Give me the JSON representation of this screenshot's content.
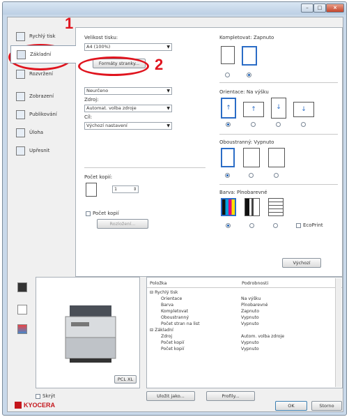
{
  "window": {
    "min_label": "–",
    "max_label": "□",
    "close_label": "×"
  },
  "annotations": {
    "step1": "1",
    "step2": "2"
  },
  "sidebar": {
    "items": [
      {
        "label": "Rychlý tisk"
      },
      {
        "label": "Základní"
      },
      {
        "label": "Rozvržení"
      },
      {
        "label": "Zobrazení"
      },
      {
        "label": "Publikování"
      },
      {
        "label": "Úloha"
      },
      {
        "label": "Upřesnit"
      }
    ]
  },
  "basic": {
    "print_size_label": "Velikost tisku:",
    "print_size_value": "A4 (100%)",
    "page_formats_button": "Formáty stranky...",
    "media_value": "Neurčeno",
    "source_label": "Zdroj:",
    "source_value": "Automat. volba zdroje",
    "dest_label": "Cíl:",
    "dest_value": "Výchozí nastavení",
    "copies_label": "Počet kopií:",
    "copies_value": "1",
    "collate_label": "Počet kopií",
    "collate_button": "Rozložení...",
    "collate_combine_label": "Kompletovat",
    "collate_on_label": "Zapnuto",
    "orientation_label": "Orientace:",
    "orientation_value": "Na výšku",
    "duplex_label": "Oboustranný:",
    "duplex_value": "Vypnuto",
    "color_label": "Barva:",
    "color_value": "Plnobarevné",
    "ecoprint_label": "EcoPrint",
    "reset_button": "Výchozí"
  },
  "preview": {
    "model_label": "PCL XL"
  },
  "summary": {
    "headers": [
      "Položka",
      "Podrobnosti"
    ],
    "rows": [
      {
        "key": "⊟ Rychlý tisk",
        "value": ""
      },
      {
        "key": "Orientace",
        "value": "Na výšku"
      },
      {
        "key": "Barva",
        "value": "Plnobarevné"
      },
      {
        "key": "Kompletovat",
        "value": "Zapnuto"
      },
      {
        "key": "Oboustranný",
        "value": "Vypnuto"
      },
      {
        "key": "Počet stran na list",
        "value": "Vypnuto"
      },
      {
        "key": "⊟ Základní",
        "value": ""
      },
      {
        "key": "Zdroj",
        "value": "Autom. volba zdroje"
      },
      {
        "key": "Počet kopií",
        "value": "Vypnuto"
      },
      {
        "key": "Počet kopií",
        "value": "Vypnuto"
      }
    ]
  },
  "footer": {
    "hide_label": "Skrýt",
    "save_as_button": "Uložit jako...",
    "profiles_button": "Profily...",
    "brand": "KYOCERA",
    "ok_button": "OK",
    "cancel_button": "Storno"
  },
  "colors": {
    "annotation": "#e0141e",
    "selected_border": "#2a6cc6",
    "brand": "#c4161c"
  }
}
